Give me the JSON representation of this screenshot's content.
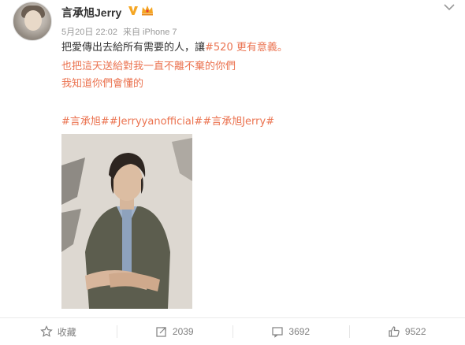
{
  "post": {
    "username": "言承旭Jerry",
    "date": "5月20日 22:02",
    "source": "来自 iPhone 7",
    "lines": {
      "line1_prefix": "把愛傳出去給所有需要的人，讓",
      "line1_tag": "#520 更有意義。",
      "line2": "也把這天送給對我一直不離不棄的你們",
      "line3": "我知道你們會懂的",
      "hashtags": "#言承旭##Jerryyanofficial##言承旭Jerry#"
    }
  },
  "actions": {
    "favorite": "收藏",
    "repost": "2039",
    "comment": "3692",
    "like": "9522"
  },
  "colors": {
    "accent": "#eb7350",
    "vip_badge": "#f5a623",
    "muted": "#999999"
  },
  "icons": [
    "avatar",
    "verified-v-icon",
    "vip-crown-icon",
    "chevron-down-icon",
    "star-icon",
    "repost-icon",
    "comment-icon",
    "thumbs-up-icon"
  ]
}
